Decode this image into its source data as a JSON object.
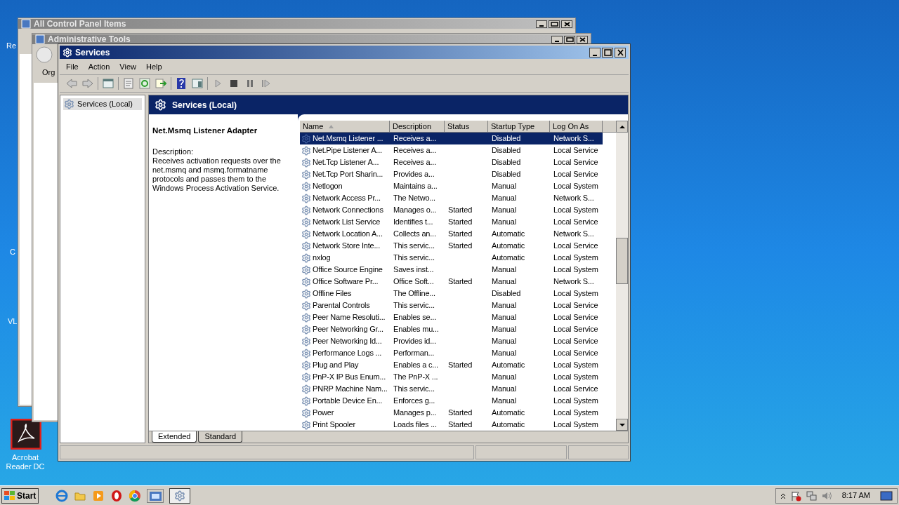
{
  "desktop": {
    "icons": [
      {
        "label": "Re"
      },
      {
        "label": "C"
      },
      {
        "label": "VL"
      },
      {
        "label": "Acrobat Reader DC"
      }
    ]
  },
  "background_windows": [
    {
      "title": "All Control Panel Items"
    },
    {
      "title": "Administrative Tools",
      "toolbar_text": "Org"
    }
  ],
  "window": {
    "title": "Services",
    "menu": [
      "File",
      "Action",
      "View",
      "Help"
    ],
    "tree": [
      {
        "label": "Services (Local)",
        "selected": true
      }
    ],
    "header": "Services (Local)",
    "detail": {
      "title": "Net.Msmq Listener Adapter",
      "description_label": "Description:",
      "description": "Receives activation requests over the net.msmq and msmq.formatname protocols and passes them to the Windows Process Activation Service."
    },
    "table": {
      "columns": [
        {
          "label": "Name",
          "sorted": true
        },
        {
          "label": "Description",
          "sorted": false
        },
        {
          "label": "Status",
          "sorted": false
        },
        {
          "label": "Startup Type",
          "sorted": false
        },
        {
          "label": "Log On As",
          "sorted": false
        }
      ],
      "rows": [
        {
          "selected": true,
          "cells": [
            "Net.Msmq Listener ...",
            "Receives a...",
            "",
            "Disabled",
            "Network S..."
          ]
        },
        {
          "selected": false,
          "cells": [
            "Net.Pipe Listener A...",
            "Receives a...",
            "",
            "Disabled",
            "Local Service"
          ]
        },
        {
          "selected": false,
          "cells": [
            "Net.Tcp Listener A...",
            "Receives a...",
            "",
            "Disabled",
            "Local Service"
          ]
        },
        {
          "selected": false,
          "cells": [
            "Net.Tcp Port Sharin...",
            "Provides a...",
            "",
            "Disabled",
            "Local Service"
          ]
        },
        {
          "selected": false,
          "cells": [
            "Netlogon",
            "Maintains a...",
            "",
            "Manual",
            "Local System"
          ]
        },
        {
          "selected": false,
          "cells": [
            "Network Access Pr...",
            "The Netwo...",
            "",
            "Manual",
            "Network S..."
          ]
        },
        {
          "selected": false,
          "cells": [
            "Network Connections",
            "Manages o...",
            "Started",
            "Manual",
            "Local System"
          ]
        },
        {
          "selected": false,
          "cells": [
            "Network List Service",
            "Identifies t...",
            "Started",
            "Manual",
            "Local Service"
          ]
        },
        {
          "selected": false,
          "cells": [
            "Network Location A...",
            "Collects an...",
            "Started",
            "Automatic",
            "Network S..."
          ]
        },
        {
          "selected": false,
          "cells": [
            "Network Store Inte...",
            "This servic...",
            "Started",
            "Automatic",
            "Local Service"
          ]
        },
        {
          "selected": false,
          "cells": [
            "nxlog",
            "This servic...",
            "",
            "Automatic",
            "Local System"
          ]
        },
        {
          "selected": false,
          "cells": [
            "Office  Source Engine",
            "Saves inst...",
            "",
            "Manual",
            "Local System"
          ]
        },
        {
          "selected": false,
          "cells": [
            "Office Software Pr...",
            "Office Soft...",
            "Started",
            "Manual",
            "Network S..."
          ]
        },
        {
          "selected": false,
          "cells": [
            "Offline Files",
            "The Offline...",
            "",
            "Disabled",
            "Local System"
          ]
        },
        {
          "selected": false,
          "cells": [
            "Parental Controls",
            "This servic...",
            "",
            "Manual",
            "Local Service"
          ]
        },
        {
          "selected": false,
          "cells": [
            "Peer Name Resoluti...",
            "Enables se...",
            "",
            "Manual",
            "Local Service"
          ]
        },
        {
          "selected": false,
          "cells": [
            "Peer Networking Gr...",
            "Enables mu...",
            "",
            "Manual",
            "Local Service"
          ]
        },
        {
          "selected": false,
          "cells": [
            "Peer Networking Id...",
            "Provides id...",
            "",
            "Manual",
            "Local Service"
          ]
        },
        {
          "selected": false,
          "cells": [
            "Performance Logs ...",
            "Performan...",
            "",
            "Manual",
            "Local Service"
          ]
        },
        {
          "selected": false,
          "cells": [
            "Plug and Play",
            "Enables a c...",
            "Started",
            "Automatic",
            "Local System"
          ]
        },
        {
          "selected": false,
          "cells": [
            "PnP-X IP Bus Enum...",
            "The PnP-X ...",
            "",
            "Manual",
            "Local System"
          ]
        },
        {
          "selected": false,
          "cells": [
            "PNRP Machine Nam...",
            "This servic...",
            "",
            "Manual",
            "Local Service"
          ]
        },
        {
          "selected": false,
          "cells": [
            "Portable Device En...",
            "Enforces g...",
            "",
            "Manual",
            "Local System"
          ]
        },
        {
          "selected": false,
          "cells": [
            "Power",
            "Manages p...",
            "Started",
            "Automatic",
            "Local System"
          ]
        },
        {
          "selected": false,
          "cells": [
            "Print Spooler",
            "Loads files ...",
            "Started",
            "Automatic",
            "Local System"
          ]
        }
      ]
    },
    "tabs": [
      {
        "label": "Extended",
        "selected": true
      },
      {
        "label": "Standard",
        "selected": false
      }
    ]
  },
  "taskbar": {
    "start": "Start",
    "clock": "8:17 AM"
  }
}
